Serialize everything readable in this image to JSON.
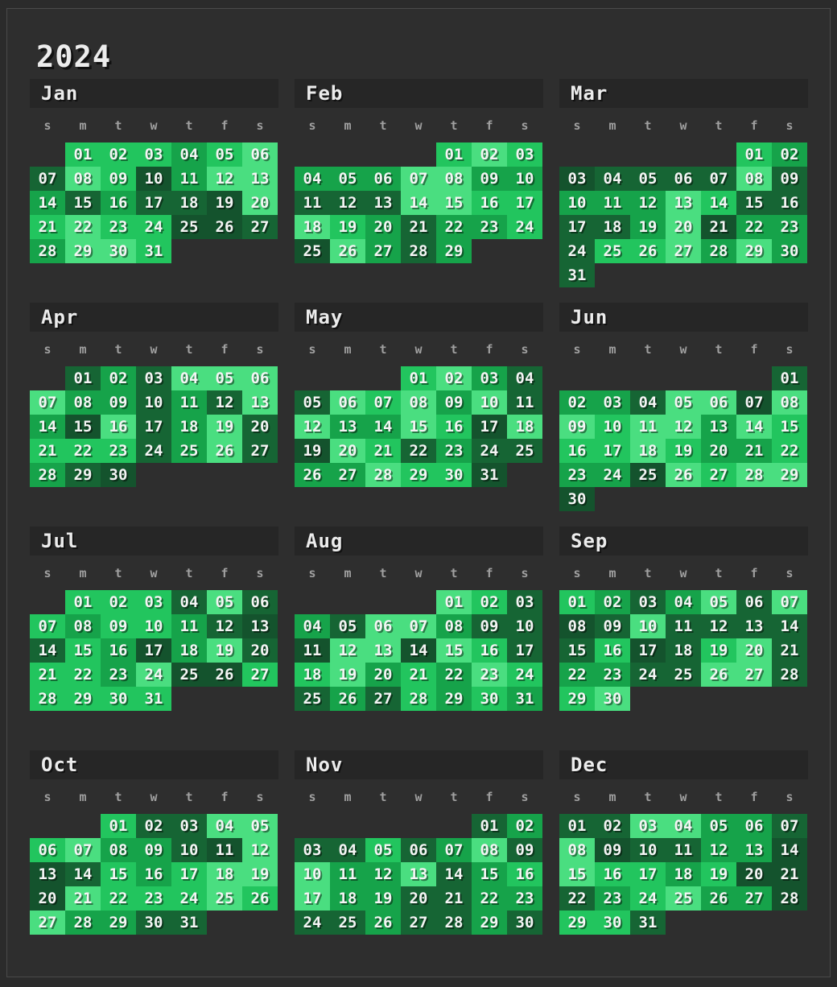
{
  "year": "2024",
  "weekday_labels": [
    "s",
    "m",
    "t",
    "w",
    "t",
    "f",
    "s"
  ],
  "level_colors": [
    "#14532d",
    "#166534",
    "#16a34a",
    "#22c55e",
    "#4ade80"
  ],
  "months": [
    {
      "name": "Jan",
      "first_weekday": 1,
      "days": 31,
      "levels": [
        3,
        3,
        3,
        2,
        3,
        4,
        1,
        4,
        3,
        0,
        2,
        4,
        4,
        2,
        1,
        2,
        1,
        1,
        0,
        4,
        3,
        4,
        3,
        3,
        0,
        0,
        1,
        2,
        4,
        4,
        3
      ]
    },
    {
      "name": "Feb",
      "first_weekday": 4,
      "days": 29,
      "levels": [
        3,
        4,
        3,
        2,
        2,
        2,
        4,
        4,
        2,
        2,
        1,
        1,
        1,
        4,
        4,
        3,
        3,
        4,
        3,
        2,
        1,
        2,
        2,
        3,
        0,
        4,
        2,
        1,
        2
      ]
    },
    {
      "name": "Mar",
      "first_weekday": 5,
      "days": 31,
      "levels": [
        3,
        2,
        0,
        1,
        1,
        1,
        1,
        4,
        1,
        2,
        2,
        2,
        4,
        3,
        1,
        1,
        1,
        1,
        2,
        4,
        0,
        2,
        2,
        1,
        3,
        3,
        4,
        2,
        4,
        2,
        1
      ]
    },
    {
      "name": "Apr",
      "first_weekday": 1,
      "days": 30,
      "levels": [
        1,
        2,
        1,
        4,
        4,
        4,
        4,
        2,
        2,
        1,
        2,
        1,
        4,
        2,
        0,
        4,
        1,
        2,
        4,
        1,
        3,
        3,
        3,
        1,
        2,
        4,
        1,
        2,
        1,
        0
      ]
    },
    {
      "name": "May",
      "first_weekday": 3,
      "days": 31,
      "levels": [
        3,
        4,
        2,
        1,
        1,
        4,
        3,
        4,
        2,
        4,
        1,
        4,
        2,
        2,
        4,
        3,
        0,
        4,
        0,
        4,
        3,
        1,
        2,
        1,
        1,
        2,
        2,
        4,
        3,
        3,
        0
      ]
    },
    {
      "name": "Jun",
      "first_weekday": 6,
      "days": 30,
      "levels": [
        1,
        2,
        2,
        1,
        4,
        4,
        0,
        4,
        4,
        3,
        4,
        4,
        2,
        4,
        3,
        3,
        3,
        4,
        3,
        2,
        2,
        3,
        2,
        2,
        0,
        4,
        3,
        4,
        4,
        0
      ]
    },
    {
      "name": "Jul",
      "first_weekday": 1,
      "days": 31,
      "levels": [
        3,
        3,
        3,
        1,
        4,
        1,
        3,
        2,
        3,
        3,
        2,
        1,
        0,
        1,
        3,
        2,
        0,
        2,
        4,
        1,
        3,
        3,
        2,
        4,
        0,
        0,
        3,
        3,
        3,
        3,
        3
      ]
    },
    {
      "name": "Aug",
      "first_weekday": 4,
      "days": 31,
      "levels": [
        4,
        3,
        1,
        2,
        1,
        4,
        4,
        2,
        1,
        1,
        0,
        4,
        4,
        0,
        4,
        3,
        1,
        3,
        4,
        2,
        3,
        2,
        4,
        3,
        1,
        2,
        1,
        3,
        2,
        3,
        2
      ]
    },
    {
      "name": "Sep",
      "first_weekday": 0,
      "days": 30,
      "levels": [
        3,
        2,
        1,
        2,
        4,
        1,
        4,
        0,
        1,
        4,
        1,
        1,
        1,
        1,
        1,
        3,
        0,
        1,
        3,
        4,
        1,
        2,
        2,
        1,
        1,
        4,
        4,
        1,
        3,
        4
      ]
    },
    {
      "name": "Oct",
      "first_weekday": 2,
      "days": 31,
      "levels": [
        3,
        1,
        1,
        4,
        4,
        3,
        4,
        2,
        2,
        1,
        0,
        4,
        0,
        1,
        3,
        2,
        3,
        4,
        4,
        0,
        4,
        3,
        3,
        3,
        4,
        3,
        4,
        2,
        2,
        1,
        1
      ]
    },
    {
      "name": "Nov",
      "first_weekday": 5,
      "days": 30,
      "levels": [
        1,
        2,
        1,
        1,
        3,
        1,
        2,
        4,
        1,
        4,
        2,
        2,
        4,
        1,
        2,
        3,
        4,
        2,
        2,
        1,
        1,
        2,
        2,
        1,
        1,
        2,
        1,
        1,
        2,
        1
      ]
    },
    {
      "name": "Dec",
      "first_weekday": 0,
      "days": 31,
      "levels": [
        1,
        1,
        4,
        4,
        2,
        2,
        1,
        4,
        0,
        1,
        1,
        2,
        2,
        0,
        4,
        3,
        3,
        2,
        3,
        0,
        0,
        1,
        2,
        3,
        4,
        2,
        2,
        0,
        3,
        3,
        1
      ]
    }
  ]
}
